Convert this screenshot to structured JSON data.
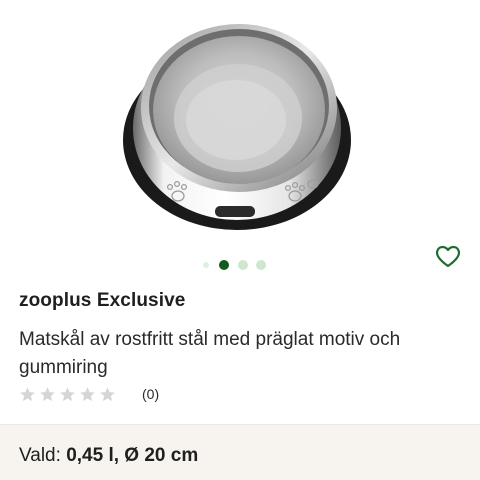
{
  "product": {
    "brand": "zooplus Exclusive",
    "title": "Matskål av rostfritt stål med präglat motiv och gummiring",
    "rating": {
      "stars_filled": 0,
      "stars_total": 5,
      "review_count": "(0)"
    },
    "variant": {
      "label": "Vald:",
      "value": "0,45 l, Ø 20 cm"
    }
  },
  "carousel": {
    "total_images": 4,
    "active_index": 1
  },
  "colors": {
    "accent": "#1e6b2f",
    "dot_active": "#155a1f",
    "dot_inactive": "#cfe6cf",
    "star_empty": "#d6d6d6",
    "variant_bg": "#f7f4ef"
  },
  "icons": {
    "wishlist": "heart-outline-icon",
    "star": "star-icon"
  }
}
